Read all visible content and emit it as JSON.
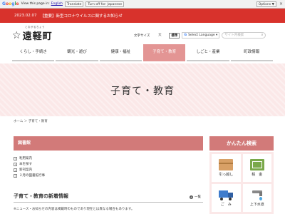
{
  "translate_bar": {
    "logo": [
      "G",
      "o",
      "o",
      "g",
      "l",
      "e"
    ],
    "prefix": "Translate",
    "view_text": "View this page in:",
    "language": "English",
    "translate_button": "Translate",
    "turn_off": "Turn off for: Japanese",
    "options": "Options ▼",
    "close": "×"
  },
  "alert": {
    "date": "2023.02.07",
    "text": "【重要】新型コロナウイルスに関するお知らせ",
    "color": "#d8322c"
  },
  "header": {
    "logo_ruby": "とおがるちょう",
    "logo_name": "遠軽町",
    "font_size_label": "文字サイズ",
    "size_large": "大",
    "size_standard": "標準",
    "google_select": "Select Language",
    "search_placeholder": "サイト内検索"
  },
  "nav": {
    "items": [
      {
        "label": "くらし・手続き",
        "active": false
      },
      {
        "label": "観光・遊び",
        "active": false
      },
      {
        "label": "健康・福祉",
        "active": false
      },
      {
        "label": "子育て・教育",
        "active": true
      },
      {
        "label": "しごと・産業",
        "active": false
      },
      {
        "label": "町政情報",
        "active": false
      }
    ],
    "accent": "#e39594"
  },
  "hero": {
    "title": "子育て・教育"
  },
  "breadcrumb": "ホーム ＞ 子育て・教育",
  "library": {
    "title": "図書館",
    "links": [
      "利用案内",
      "本を探す",
      "新刊案内",
      "２月の図書館行事"
    ]
  },
  "news": {
    "title": "子育て・教育の新着情報",
    "more": "一覧",
    "notice": "※ニュース・お知らせの内容は掲載時のものであり現在とは異なる場合もあります。"
  },
  "quick_search": {
    "title": "かんたん検索",
    "tiles": [
      {
        "label": "引っ越し",
        "icon": "moving-box-icon"
      },
      {
        "label": "税　金",
        "icon": "tax-icon"
      },
      {
        "label": "ご　み",
        "icon": "garbage-truck-icon"
      },
      {
        "label": "上下水道",
        "icon": "water-tap-icon"
      }
    ]
  }
}
